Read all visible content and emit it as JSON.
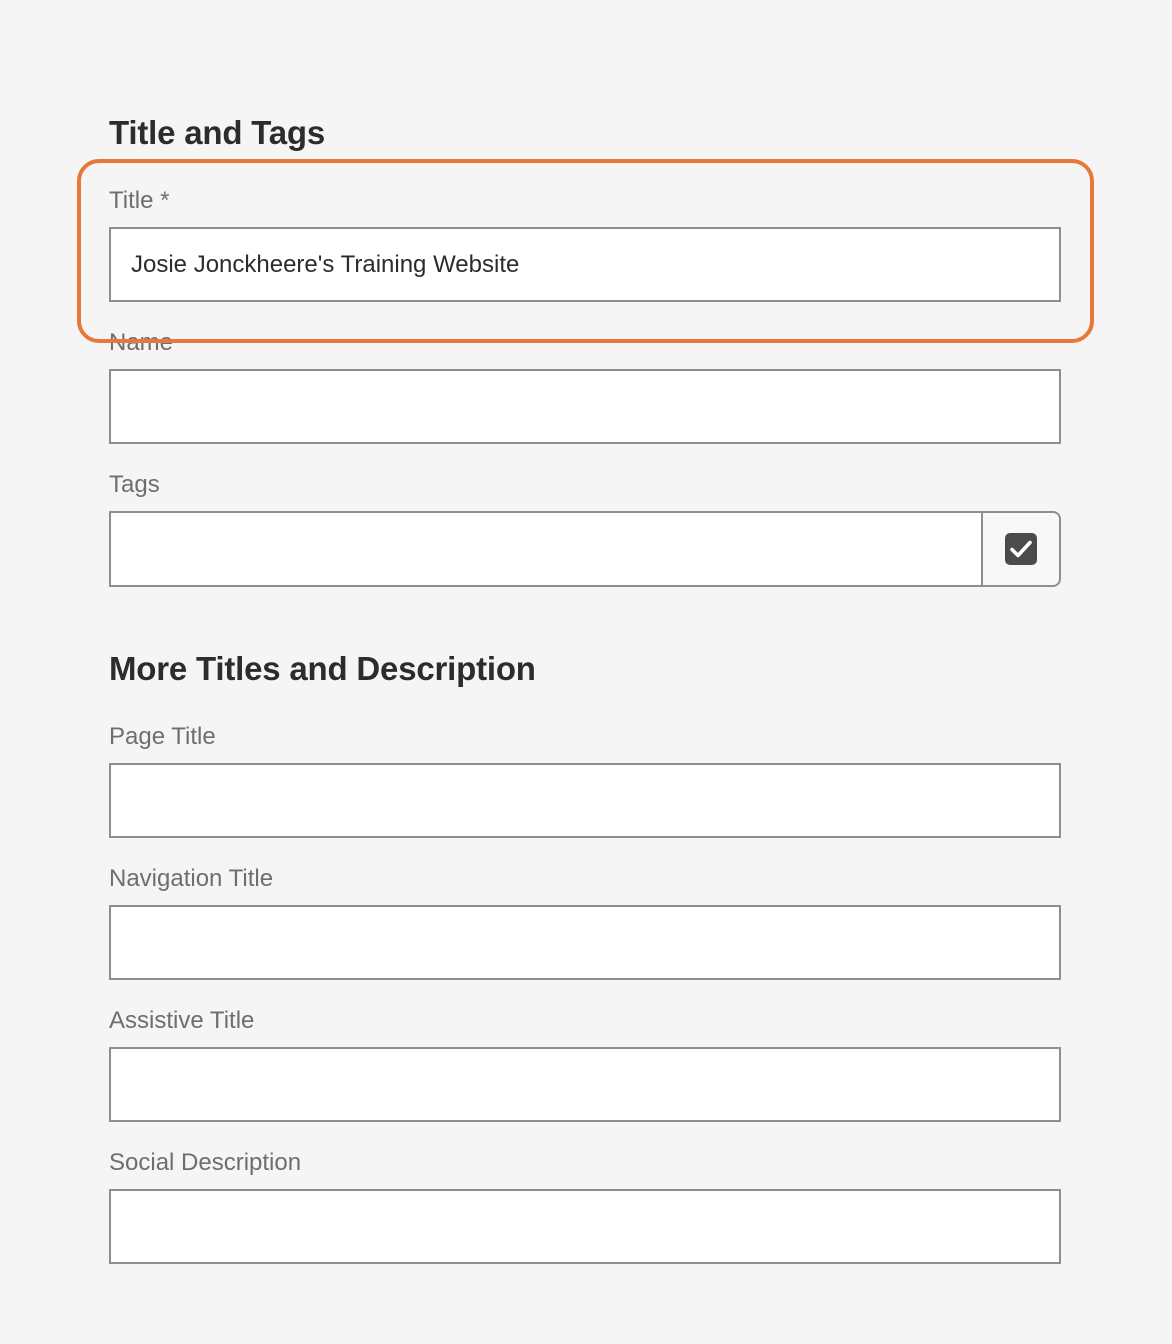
{
  "sections": {
    "title_and_tags": {
      "heading": "Title and Tags",
      "title_label": "Title *",
      "title_value": "Josie Jonckheere's Training Website",
      "name_label": "Name",
      "name_value": "",
      "tags_label": "Tags",
      "tags_value": "",
      "tags_picker_icon": "checkbox-check-icon"
    },
    "more_titles": {
      "heading": "More Titles and Description",
      "page_title_label": "Page Title",
      "page_title_value": "",
      "navigation_title_label": "Navigation Title",
      "navigation_title_value": "",
      "assistive_title_label": "Assistive Title",
      "assistive_title_value": "",
      "social_description_label": "Social Description",
      "social_description_value": ""
    }
  },
  "colors": {
    "background": "#f5f5f5",
    "highlight": "#e8773a",
    "field_border": "#8e8e8e",
    "label": "#6e6e6e",
    "icon": "#4b4b4b"
  }
}
